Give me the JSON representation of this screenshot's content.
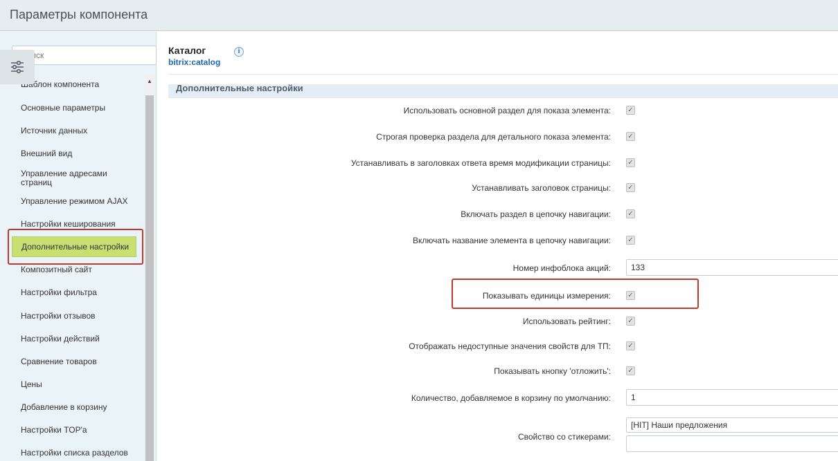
{
  "header": {
    "title": "Параметры компонента"
  },
  "sidebar": {
    "search_placeholder": "Поиск",
    "items": [
      "Шаблон компонента",
      "Основные параметры",
      "Источник данных",
      "Внешний вид",
      "Управление адресами страниц",
      "Управление режимом AJAX",
      "Настройки кеширования",
      "Дополнительные настройки",
      "Композитный сайт",
      "Настройки фильтра",
      "Настройки отзывов",
      "Настройки действий",
      "Сравнение товаров",
      "Цены",
      "Добавление в корзину",
      "Настройки TOP'а",
      "Настройки списка разделов"
    ],
    "active_item": "Дополнительные настройки"
  },
  "component": {
    "title": "Каталог",
    "code": "bitrix:catalog",
    "info_icon": "i"
  },
  "section": {
    "title": "Дополнительные настройки"
  },
  "params": [
    {
      "label": "Использовать основной раздел для показа элемента:",
      "type": "checkbox",
      "checked": true
    },
    {
      "label": "Строгая проверка раздела для детального показа элемента:",
      "type": "checkbox",
      "checked": true
    },
    {
      "label": "Устанавливать в заголовках ответа время модификации страницы:",
      "type": "checkbox",
      "checked": true
    },
    {
      "label": "Устанавливать заголовок страницы:",
      "type": "checkbox",
      "checked": true
    },
    {
      "label": "Включать раздел в цепочку навигации:",
      "type": "checkbox",
      "checked": true
    },
    {
      "label": "Включать название элемента в цепочку навигации:",
      "type": "checkbox",
      "checked": true
    },
    {
      "label": "Номер инфоблока акций:",
      "type": "text",
      "value": "133"
    },
    {
      "label": "Показывать единицы измерения:",
      "type": "checkbox",
      "checked": true
    },
    {
      "label": "Использовать рейтинг:",
      "type": "checkbox",
      "checked": true
    },
    {
      "label": "Отображать недоступные значения свойств для ТП:",
      "type": "checkbox",
      "checked": true
    },
    {
      "label": "Показывать кнопку 'отложить':",
      "type": "checkbox",
      "checked": true
    },
    {
      "label": "Количество, добавляемое в корзину по умолчанию:",
      "type": "text",
      "value": "1"
    },
    {
      "label": "Свойство со стикерами:",
      "type": "select",
      "value": "[HIT] Наши предложения"
    }
  ],
  "colors": {
    "active_item_bg": "#c8df72",
    "highlight_border": "#c0392b",
    "link": "#2067b0"
  }
}
